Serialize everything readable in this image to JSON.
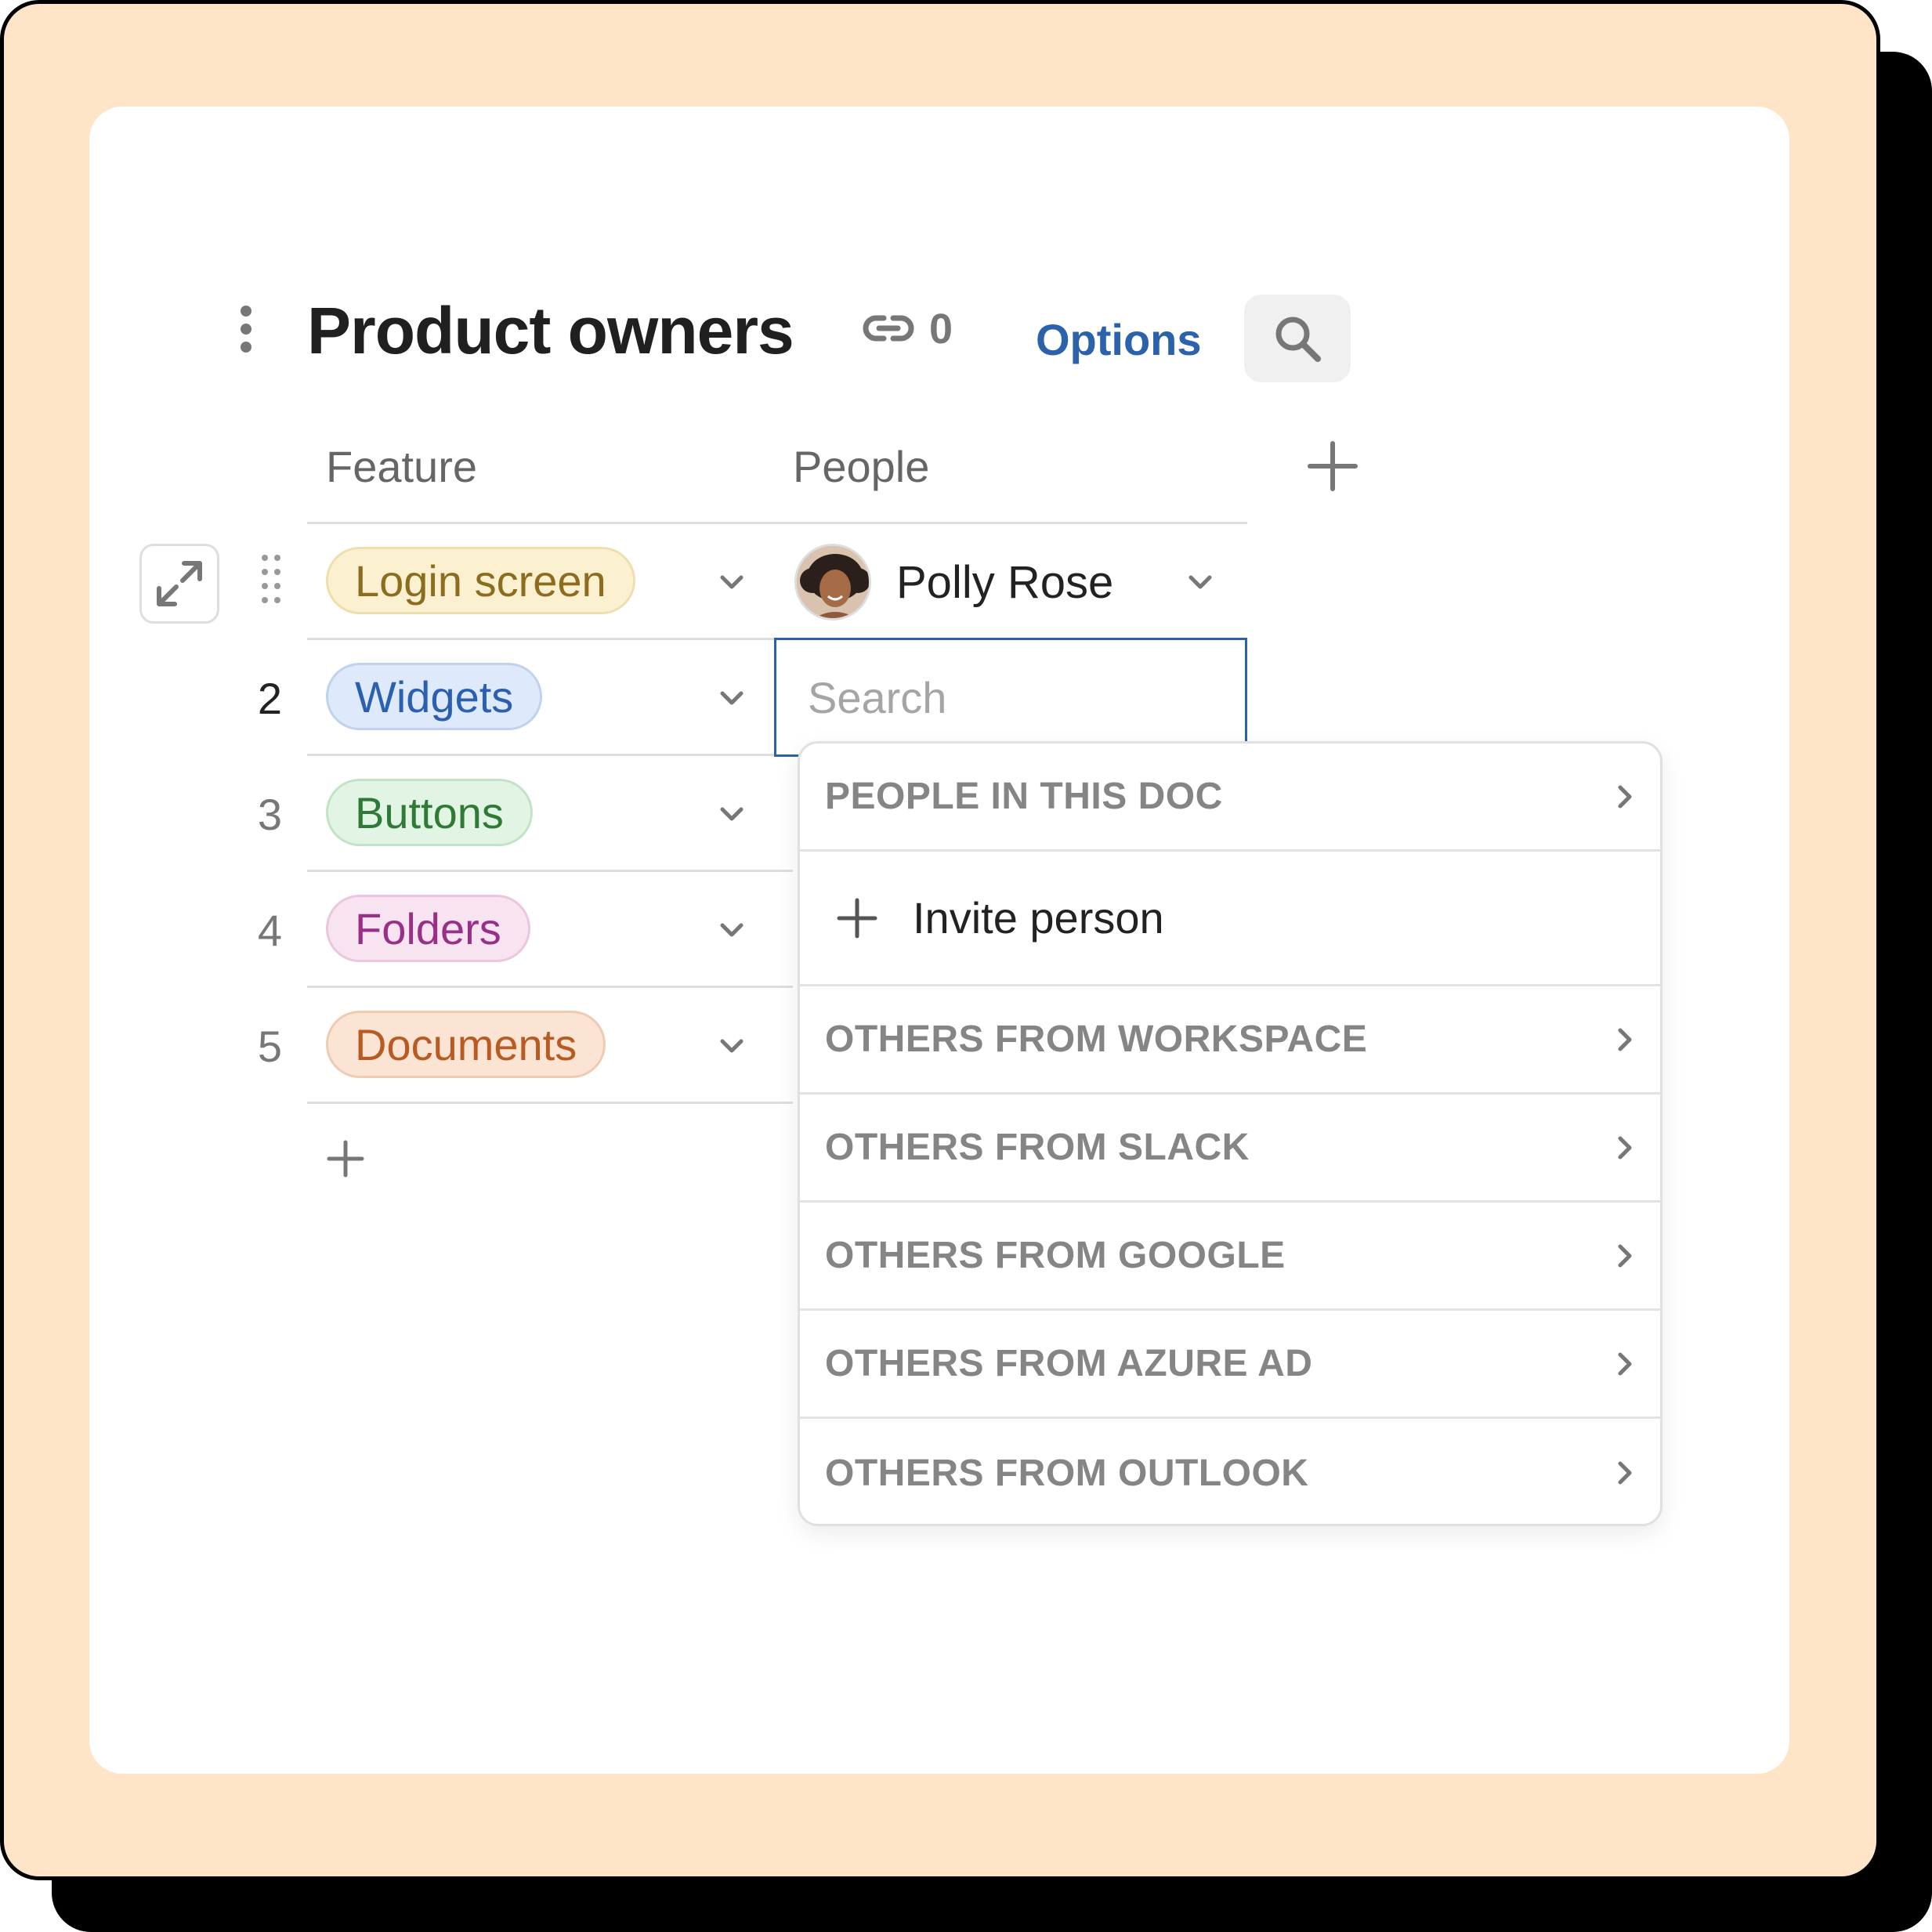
{
  "table": {
    "title": "Product owners",
    "link_count": "0",
    "options_label": "Options",
    "columns": {
      "feature": "Feature",
      "people": "People"
    }
  },
  "rows": [
    {
      "num": "",
      "feature": "Login screen",
      "tag_bg": "#fbf1d0",
      "tag_border": "#eddfae",
      "tag_color": "#8c6d1f",
      "person": "Polly Rose"
    },
    {
      "num": "2",
      "feature": "Widgets",
      "tag_bg": "#deeafb",
      "tag_border": "#bfd2ee",
      "tag_color": "#2b5fb0",
      "active": true
    },
    {
      "num": "3",
      "feature": "Buttons",
      "tag_bg": "#e2f4e3",
      "tag_border": "#c3e3c6",
      "tag_color": "#2e7a36"
    },
    {
      "num": "4",
      "feature": "Folders",
      "tag_bg": "#f8e3f0",
      "tag_border": "#ebc6de",
      "tag_color": "#9a2f87"
    },
    {
      "num": "5",
      "feature": "Documents",
      "tag_bg": "#fbe4d3",
      "tag_border": "#efcbb0",
      "tag_color": "#b95a22"
    }
  ],
  "people_picker": {
    "search_placeholder": "Search",
    "sections": [
      "PEOPLE IN THIS DOC",
      "OTHERS FROM WORKSPACE",
      "OTHERS FROM SLACK",
      "OTHERS FROM GOOGLE",
      "OTHERS FROM AZURE AD",
      "OTHERS FROM OUTLOOK"
    ],
    "invite_label": "Invite person"
  },
  "colors": {
    "background": "#fee5c8",
    "accent": "#2b62aa",
    "panel": "#ffffff"
  },
  "icons": [
    "kebab-menu-icon",
    "link-icon",
    "search-icon",
    "plus-icon",
    "expand-icon",
    "drag-handle-icon",
    "chevron-down-icon",
    "chevron-right-icon"
  ]
}
